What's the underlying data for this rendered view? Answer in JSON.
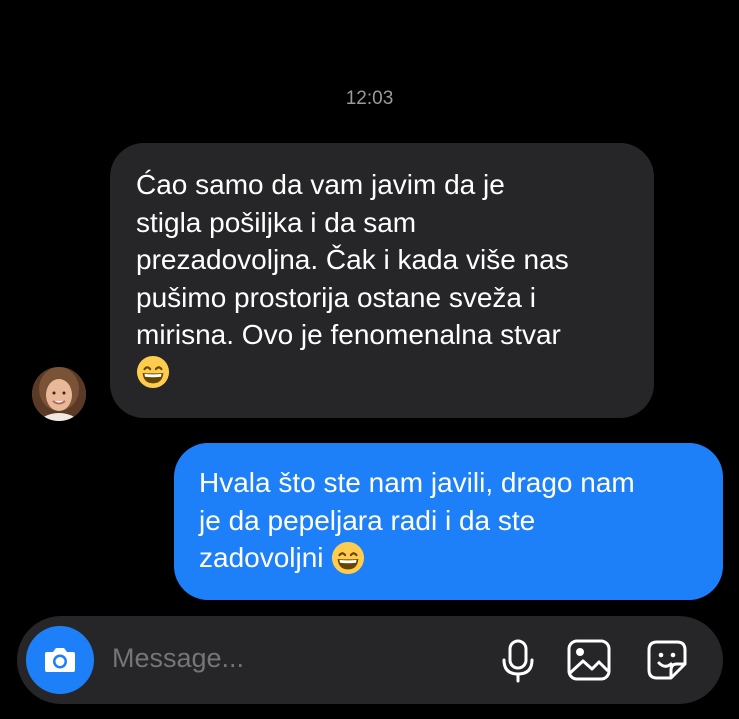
{
  "conversation": {
    "timestamp": "12:03",
    "incoming": {
      "lines": [
        "Ćao samo da vam javim da je",
        "stigla pošiljka i da sam",
        "prezadovoljna. Čak i kada više nas",
        "pušimo prostorija ostane sveža i",
        "mirisna. Ovo je fenomenalna stvar"
      ],
      "emoji": "grinning-face-with-smiling-eyes",
      "bubble_color": "#262629"
    },
    "outgoing": {
      "lines": [
        "Hvala što ste nam javili, drago nam",
        "je da pepeljara radi i da ste",
        "zadovoljni"
      ],
      "emoji": "grinning-face-with-smiling-eyes",
      "bubble_color": "#1e80f8"
    }
  },
  "composer": {
    "placeholder": "Message...",
    "icons": [
      "camera-icon",
      "microphone-icon",
      "gallery-icon",
      "sticker-icon"
    ],
    "accent_color": "#1e80f8"
  }
}
